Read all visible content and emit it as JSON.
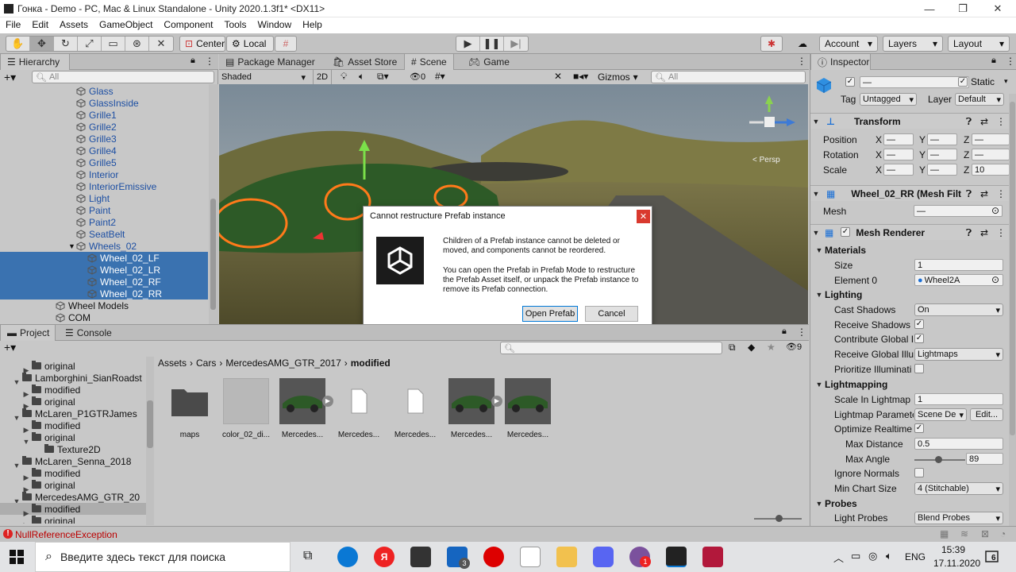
{
  "window": {
    "title": "Гонка - Demo - PC, Mac & Linux Standalone - Unity 2020.1.3f1* <DX11>"
  },
  "menu": [
    "File",
    "Edit",
    "Assets",
    "GameObject",
    "Component",
    "Tools",
    "Window",
    "Help"
  ],
  "toolbar": {
    "pivot_label": "Center",
    "space_label": "Local",
    "account_label": "Account",
    "layers_label": "Layers",
    "layout_label": "Layout"
  },
  "hierarchy": {
    "tab_label": "Hierarchy",
    "search_placeholder": "All",
    "items": [
      {
        "label": "Glass",
        "indent": 3
      },
      {
        "label": "GlassInside",
        "indent": 3
      },
      {
        "label": "Grille1",
        "indent": 3
      },
      {
        "label": "Grille2",
        "indent": 3
      },
      {
        "label": "Grille3",
        "indent": 3
      },
      {
        "label": "Grille4",
        "indent": 3
      },
      {
        "label": "Grille5",
        "indent": 3
      },
      {
        "label": "Interior",
        "indent": 3
      },
      {
        "label": "InteriorEmissive",
        "indent": 3
      },
      {
        "label": "Light",
        "indent": 3
      },
      {
        "label": "Paint",
        "indent": 3
      },
      {
        "label": "Paint2",
        "indent": 3
      },
      {
        "label": "SeatBelt",
        "indent": 3
      },
      {
        "label": "Wheels_02",
        "indent": 3
      },
      {
        "label": "Wheel_02_LF",
        "indent": 4
      },
      {
        "label": "Wheel_02_LR",
        "indent": 4
      },
      {
        "label": "Wheel_02_RF",
        "indent": 4
      },
      {
        "label": "Wheel_02_RR",
        "indent": 4
      },
      {
        "label": "Wheel Models",
        "indent": 2
      },
      {
        "label": "COM",
        "indent": 2
      }
    ]
  },
  "scene_tabs": {
    "package_manager": "Package Manager",
    "asset_store": "Asset Store",
    "scene": "Scene",
    "game": "Game"
  },
  "scene_toolbar": {
    "draw_mode": "Shaded",
    "mode_2d": "2D",
    "fx_count": "0",
    "gizmos_label": "Gizmos",
    "search_placeholder": "All",
    "persp_label": "< Persp"
  },
  "dialog": {
    "title": "Cannot restructure Prefab instance",
    "paragraph1": "Children of a Prefab instance cannot be deleted or moved, and components cannot be reordered.",
    "paragraph2": "You can open the Prefab in Prefab Mode to restructure the Prefab Asset itself, or unpack the Prefab instance to remove its Prefab connection.",
    "open_button": "Open Prefab",
    "cancel_button": "Cancel"
  },
  "project": {
    "tab_project": "Project",
    "tab_console": "Console",
    "hidden_count": "9",
    "tree": [
      {
        "label": "original",
        "indent": 3,
        "arrow": "▶"
      },
      {
        "label": "Lamborghini_SianRoadst",
        "indent": 2,
        "arrow": "▼"
      },
      {
        "label": "modified",
        "indent": 3,
        "arrow": "▶"
      },
      {
        "label": "original",
        "indent": 3,
        "arrow": "▶"
      },
      {
        "label": "McLaren_P1GTRJames",
        "indent": 2,
        "arrow": "▼"
      },
      {
        "label": "modified",
        "indent": 3,
        "arrow": "▶"
      },
      {
        "label": "original",
        "indent": 3,
        "arrow": "▼"
      },
      {
        "label": "Texture2D",
        "indent": 4,
        "arrow": ""
      },
      {
        "label": "McLaren_Senna_2018",
        "indent": 2,
        "arrow": "▼"
      },
      {
        "label": "modified",
        "indent": 3,
        "arrow": "▶"
      },
      {
        "label": "original",
        "indent": 3,
        "arrow": "▶"
      },
      {
        "label": "MercedesAMG_GTR_20",
        "indent": 2,
        "arrow": "▼"
      },
      {
        "label": "modified",
        "indent": 3,
        "arrow": "▶"
      },
      {
        "label": "original",
        "indent": 3,
        "arrow": "▶"
      }
    ],
    "breadcrumb": [
      "Assets",
      "Cars",
      "MercedesAMG_GTR_2017",
      "modified"
    ],
    "assets": [
      {
        "label": "maps",
        "kind": "folder"
      },
      {
        "label": "color_02_di...",
        "kind": "texture"
      },
      {
        "label": "Mercedes...",
        "kind": "model"
      },
      {
        "label": "Mercedes...",
        "kind": "file"
      },
      {
        "label": "Mercedes...",
        "kind": "file"
      },
      {
        "label": "Mercedes...",
        "kind": "model"
      },
      {
        "label": "Mercedes...",
        "kind": "prefab"
      }
    ]
  },
  "inspector": {
    "tab_label": "Inspector",
    "object_name": "—",
    "static_label": "Static",
    "tag_label": "Tag",
    "tag_value": "Untagged",
    "layer_label": "Layer",
    "layer_value": "Default",
    "transform": {
      "title": "Transform",
      "position_label": "Position",
      "rotation_label": "Rotation",
      "scale_label": "Scale",
      "dash": "—",
      "scale_z": "10"
    },
    "mesh_filter": {
      "title": "Wheel_02_RR (Mesh Filt",
      "mesh_label": "Mesh",
      "mesh_value": "—"
    },
    "mesh_renderer": {
      "title": "Mesh Renderer",
      "materials_label": "Materials",
      "size_label": "Size",
      "size_value": "1",
      "element0_label": "Element 0",
      "element0_value": "Wheel2A",
      "lighting_label": "Lighting",
      "cast_shadows_label": "Cast Shadows",
      "cast_shadows_value": "On",
      "receive_shadows_label": "Receive Shadows",
      "contribute_gi_label": "Contribute Global I",
      "receive_gi_label": "Receive Global Illu",
      "receive_gi_value": "Lightmaps",
      "prioritize_label": "Prioritize Illuminati",
      "lightmapping_label": "Lightmapping",
      "scale_lightmap_label": "Scale In Lightmap",
      "scale_lightmap_value": "1",
      "lightmap_params_label": "Lightmap Paramete",
      "lightmap_params_value": "Scene De",
      "edit_label": "Edit...",
      "optimize_label": "Optimize Realtime",
      "max_distance_label": "Max Distance",
      "max_distance_value": "0.5",
      "max_angle_label": "Max Angle",
      "max_angle_value": "89",
      "ignore_normals_label": "Ignore Normals",
      "min_chart_label": "Min Chart Size",
      "min_chart_value": "4 (Stitchable)",
      "probes_label": "Probes",
      "light_probes_label": "Light Probes",
      "light_probes_value": "Blend Probes"
    }
  },
  "status": {
    "error_text": "NullReferenceException"
  },
  "taskbar": {
    "search_placeholder": "Введите здесь текст для поиска",
    "mail_badge": "3",
    "viber_badge": "1",
    "lang": "ENG",
    "time": "15:39",
    "date": "17.11.2020",
    "notif_count": "6"
  },
  "colors": {
    "selection": "#3a72b0",
    "scene_sky": "#6e7d8a",
    "car_body": "#2d5a27",
    "highlight": "#ff7a1a"
  }
}
